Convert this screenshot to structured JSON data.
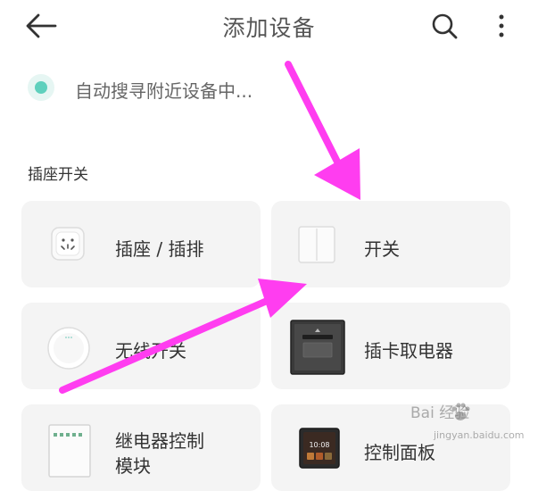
{
  "header": {
    "back_icon": "arrow-left",
    "title": "添加设备",
    "search_icon": "search",
    "more_icon": "more-vertical"
  },
  "status": {
    "text": "自动搜寻附近设备中...",
    "dot_color": "#5fd0bd"
  },
  "section": {
    "title": "插座开关"
  },
  "devices": [
    {
      "label": "插座 / 插排",
      "icon": "socket-device"
    },
    {
      "label": "开关",
      "icon": "wall-switch"
    },
    {
      "label": "无线开关",
      "icon": "wireless-switch-button"
    },
    {
      "label": "插卡取电器",
      "icon": "card-power-switch"
    },
    {
      "label": "继电器控制",
      "label_line2": "模块",
      "icon": "relay-module"
    },
    {
      "label": "控制面板",
      "icon": "control-panel"
    }
  ],
  "watermark": {
    "text": "Bai  经验",
    "sub": "jingyan.baidu.com"
  },
  "annotation": {
    "color": "#ff3df0"
  }
}
